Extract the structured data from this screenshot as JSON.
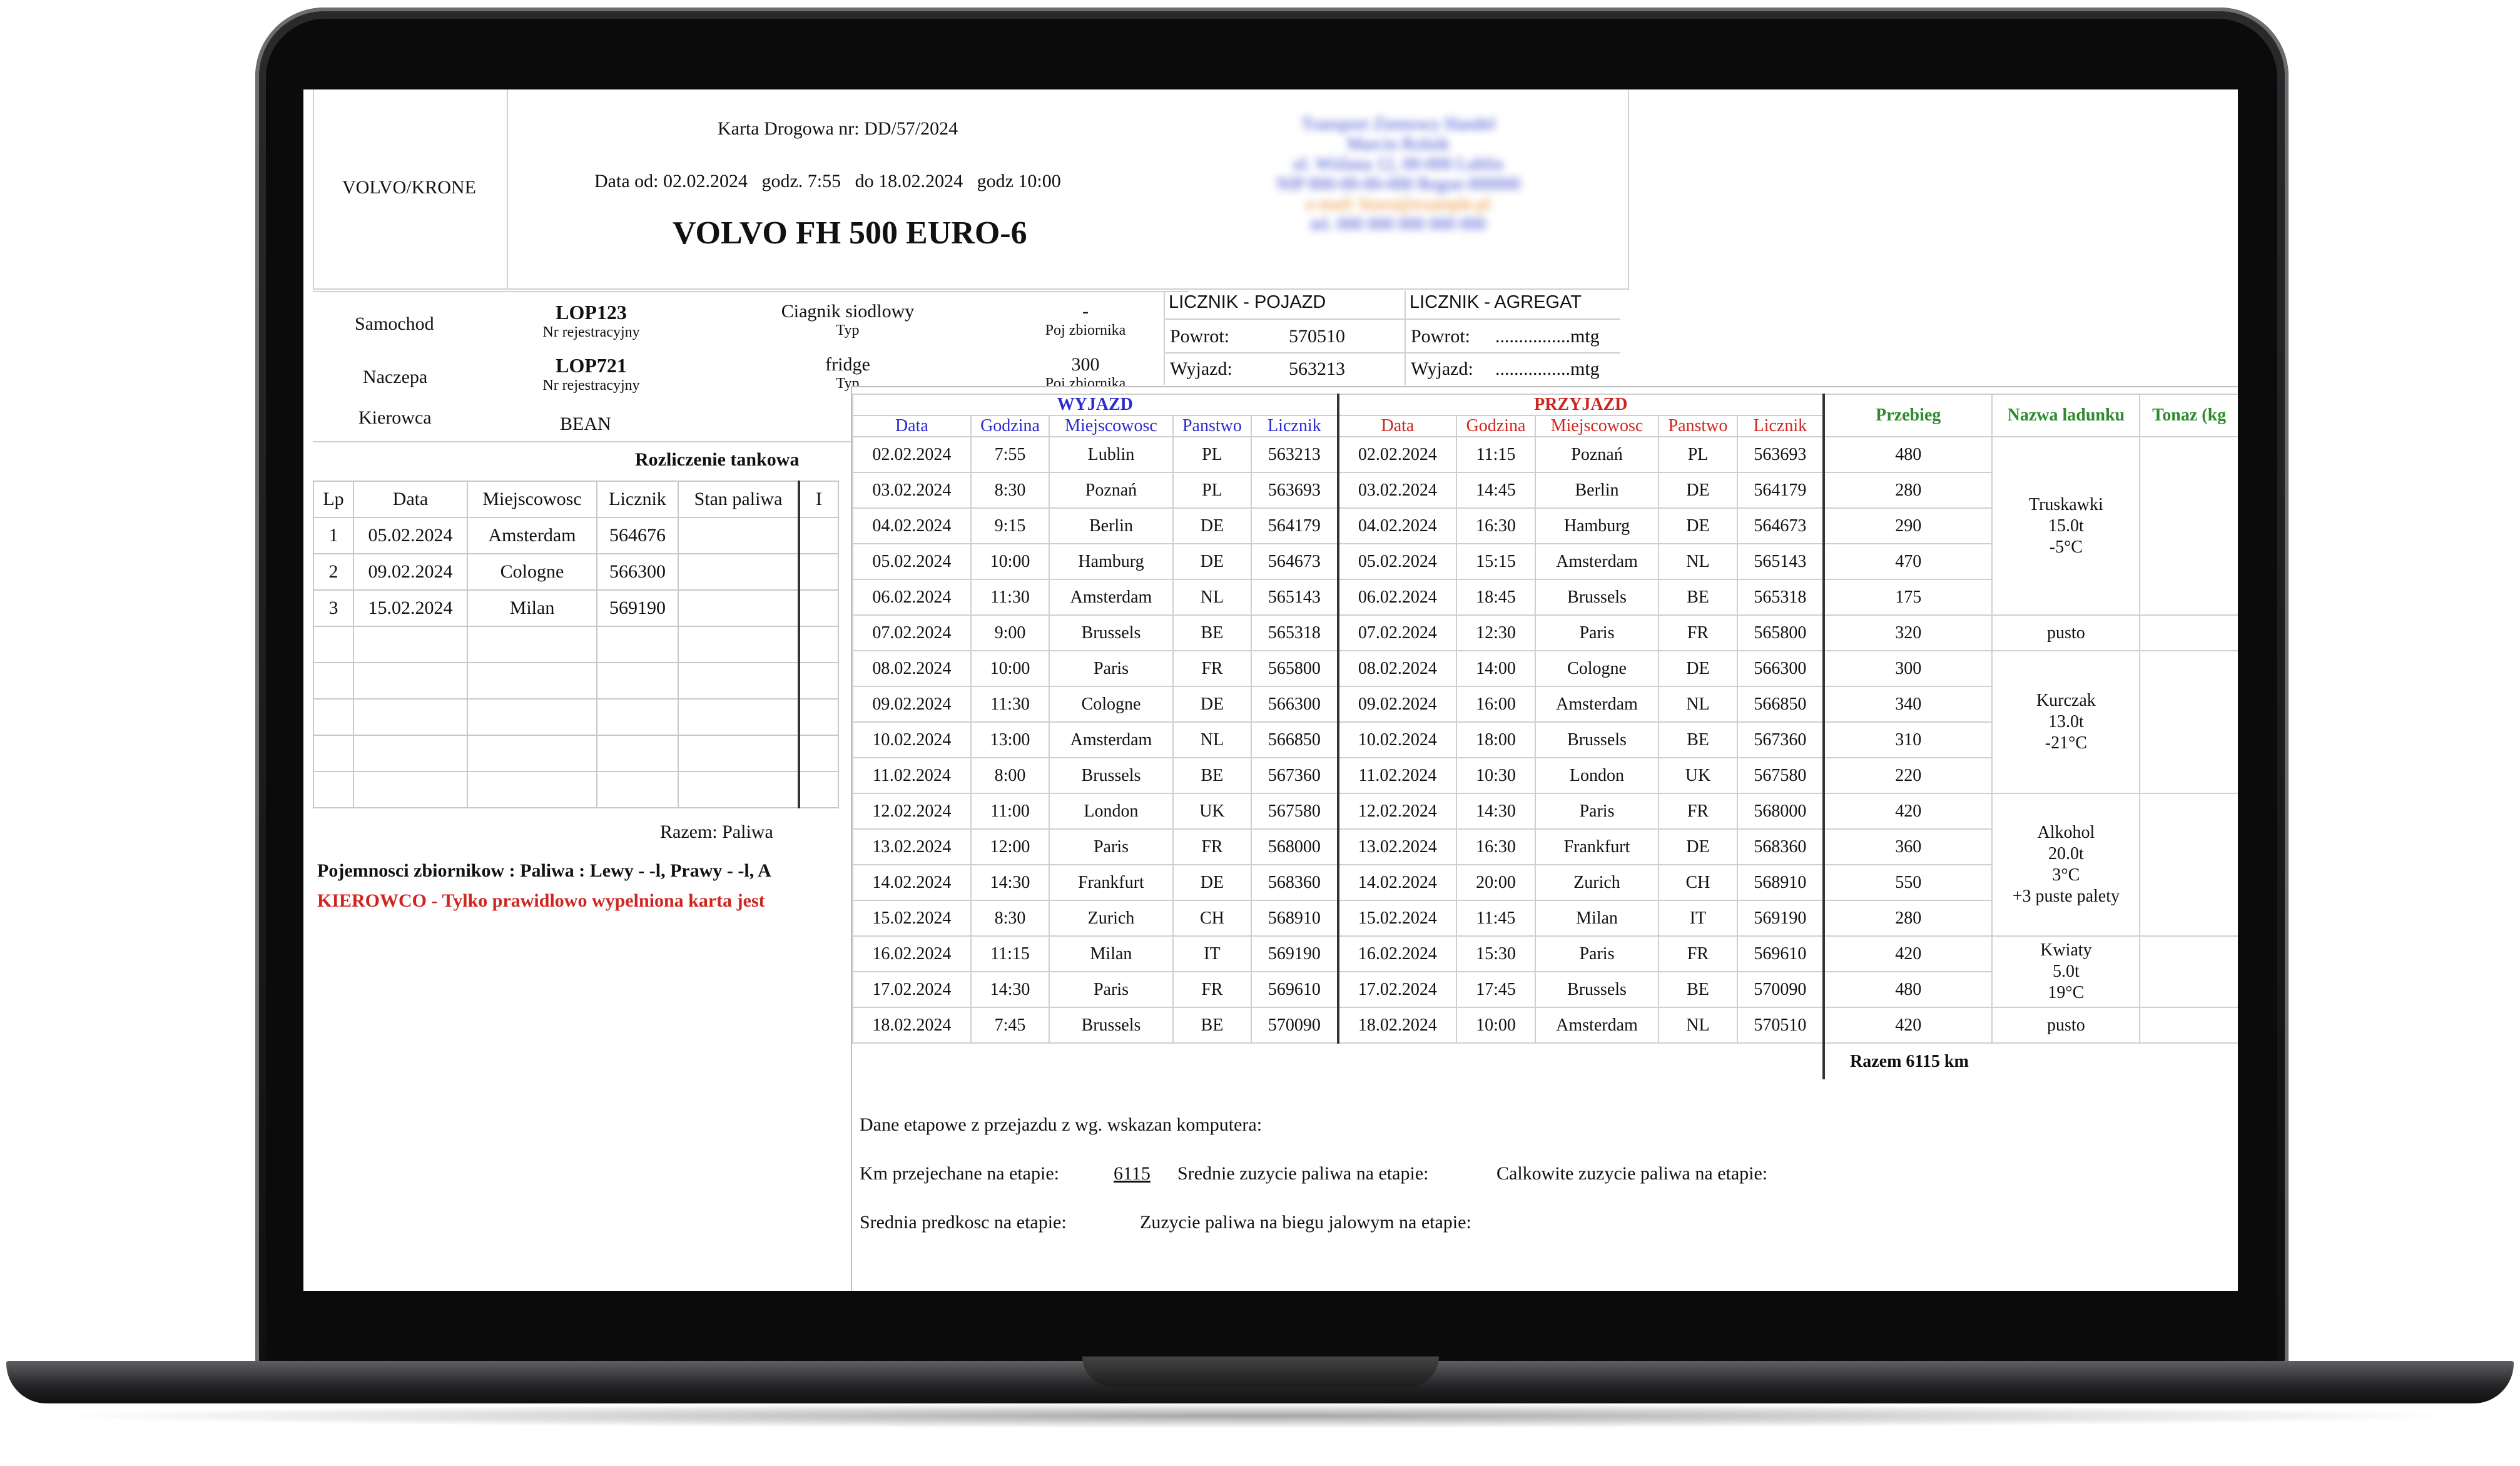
{
  "doc": {
    "vehicle_group": "VOLVO/KRONE",
    "card_title": "Karta Drogowa nr: DD/57/2024",
    "date_line": "Data od: 02.02.2024   godz. 7:55   do 18.02.2024   godz 10:00",
    "model": "VOLVO FH 500 EURO-6",
    "company_lines": [
      "Transport Ziemowy Handel",
      "Marcin Rolnik",
      "ul. Wiślana 12, 00-000 Lublin",
      "NIP 000-00-00-000   Regon 000000",
      "e-mail: biuro@example.pl",
      "tel. 000 000 000  000 000"
    ]
  },
  "vehicle": {
    "rows": [
      {
        "label": "Samochod",
        "reg": "LOP123",
        "reg_sub": "Nr rejestracyjny",
        "type": "Ciagnik siodlowy",
        "type_sub": "Typ",
        "tank": "-",
        "tank_sub": "Poj zbiornika"
      },
      {
        "label": "Naczepa",
        "reg": "LOP721",
        "reg_sub": "Nr rejestracyjny",
        "type": "fridge",
        "type_sub": "Typ",
        "tank": "300",
        "tank_sub": "Poj zbiornika"
      }
    ],
    "driver_label": "Kierowca",
    "driver": "BEAN"
  },
  "meters": {
    "vehicle_header": "LICZNIK - POJAZD",
    "unit_header": "LICZNIK - AGREGAT",
    "return_label": "Powrot:",
    "departure_label": "Wyjazd:",
    "return_value": "570510",
    "departure_value": "563213",
    "unit_return": "................mtg",
    "unit_departure": "................mtg"
  },
  "refuel": {
    "title": "Rozliczenie tankowa",
    "headers": [
      "Lp",
      "Data",
      "Miejscowosc",
      "Licznik",
      "Stan paliwa",
      "I"
    ],
    "rows": [
      [
        "1",
        "05.02.2024",
        "Amsterdam",
        "564676"
      ],
      [
        "2",
        "09.02.2024",
        "Cologne",
        "566300"
      ],
      [
        "3",
        "15.02.2024",
        "Milan",
        "569190"
      ]
    ],
    "total": "Razem: Paliwa",
    "tanks_note": "Pojemnosci zbiornikow : Paliwa : Lewy - -l, Prawy - -l, A",
    "warning": "KIEROWCO - Tylko prawidlowo wypelniona karta jest"
  },
  "trips": {
    "departure_title": "WYJAZD",
    "arrival_title": "PRZYJAZD",
    "col_headers": [
      "Data",
      "Godzina",
      "Miejscowosc",
      "Panstwo",
      "Licznik"
    ],
    "mileage_header": "Przebieg",
    "cargo_header": "Nazwa ladunku",
    "tonnage_header": "Tonaz (kg",
    "rows": [
      [
        "02.02.2024",
        "7:55",
        "Lublin",
        "PL",
        "563213",
        "02.02.2024",
        "11:15",
        "Poznań",
        "PL",
        "563693",
        "480"
      ],
      [
        "03.02.2024",
        "8:30",
        "Poznań",
        "PL",
        "563693",
        "03.02.2024",
        "14:45",
        "Berlin",
        "DE",
        "564179",
        "280"
      ],
      [
        "04.02.2024",
        "9:15",
        "Berlin",
        "DE",
        "564179",
        "04.02.2024",
        "16:30",
        "Hamburg",
        "DE",
        "564673",
        "290"
      ],
      [
        "05.02.2024",
        "10:00",
        "Hamburg",
        "DE",
        "564673",
        "05.02.2024",
        "15:15",
        "Amsterdam",
        "NL",
        "565143",
        "470"
      ],
      [
        "06.02.2024",
        "11:30",
        "Amsterdam",
        "NL",
        "565143",
        "06.02.2024",
        "18:45",
        "Brussels",
        "BE",
        "565318",
        "175"
      ],
      [
        "07.02.2024",
        "9:00",
        "Brussels",
        "BE",
        "565318",
        "07.02.2024",
        "12:30",
        "Paris",
        "FR",
        "565800",
        "320"
      ],
      [
        "08.02.2024",
        "10:00",
        "Paris",
        "FR",
        "565800",
        "08.02.2024",
        "14:00",
        "Cologne",
        "DE",
        "566300",
        "300"
      ],
      [
        "09.02.2024",
        "11:30",
        "Cologne",
        "DE",
        "566300",
        "09.02.2024",
        "16:00",
        "Amsterdam",
        "NL",
        "566850",
        "340"
      ],
      [
        "10.02.2024",
        "13:00",
        "Amsterdam",
        "NL",
        "566850",
        "10.02.2024",
        "18:00",
        "Brussels",
        "BE",
        "567360",
        "310"
      ],
      [
        "11.02.2024",
        "8:00",
        "Brussels",
        "BE",
        "567360",
        "11.02.2024",
        "10:30",
        "London",
        "UK",
        "567580",
        "220"
      ],
      [
        "12.02.2024",
        "11:00",
        "London",
        "UK",
        "567580",
        "12.02.2024",
        "14:30",
        "Paris",
        "FR",
        "568000",
        "420"
      ],
      [
        "13.02.2024",
        "12:00",
        "Paris",
        "FR",
        "568000",
        "13.02.2024",
        "16:30",
        "Frankfurt",
        "DE",
        "568360",
        "360"
      ],
      [
        "14.02.2024",
        "14:30",
        "Frankfurt",
        "DE",
        "568360",
        "14.02.2024",
        "20:00",
        "Zurich",
        "CH",
        "568910",
        "550"
      ],
      [
        "15.02.2024",
        "8:30",
        "Zurich",
        "CH",
        "568910",
        "15.02.2024",
        "11:45",
        "Milan",
        "IT",
        "569190",
        "280"
      ],
      [
        "16.02.2024",
        "11:15",
        "Milan",
        "IT",
        "569190",
        "16.02.2024",
        "15:30",
        "Paris",
        "FR",
        "569610",
        "420"
      ],
      [
        "17.02.2024",
        "14:30",
        "Paris",
        "FR",
        "569610",
        "17.02.2024",
        "17:45",
        "Brussels",
        "BE",
        "570090",
        "480"
      ],
      [
        "18.02.2024",
        "7:45",
        "Brussels",
        "BE",
        "570090",
        "18.02.2024",
        "10:00",
        "Amsterdam",
        "NL",
        "570510",
        "420"
      ]
    ],
    "cargo_groups": [
      {
        "lines": [
          "Truskawki",
          "15.0t",
          "-5°C"
        ],
        "span": 5
      },
      {
        "lines": [
          "pusto"
        ],
        "span": 1
      },
      {
        "lines": [
          "Kurczak",
          "13.0t",
          "-21°C"
        ],
        "span": 4
      },
      {
        "lines": [
          "Alkohol",
          "20.0t",
          "3°C",
          "+3 puste palety"
        ],
        "span": 4
      },
      {
        "lines": [
          "Kwiaty",
          "5.0t",
          "19°C"
        ],
        "span": 2
      },
      {
        "lines": [
          "pusto"
        ],
        "span": 1
      }
    ],
    "total": "Razem 6115 km"
  },
  "summary": {
    "intro": "Dane etapowe z przejazdu z wg. wskazan komputera:",
    "km_label": "Km przejechane na etapie:",
    "km_value": "6115",
    "avg_fuel_label": "Srednie zuzycie paliwa na etapie:",
    "total_fuel_label": "Calkowite zuzycie paliwa na etapie:",
    "avg_speed_label": "Srednia predkosc na etapie:",
    "idle_fuel_label": "Zuzycie paliwa na biegu jalowym na etapie:"
  }
}
